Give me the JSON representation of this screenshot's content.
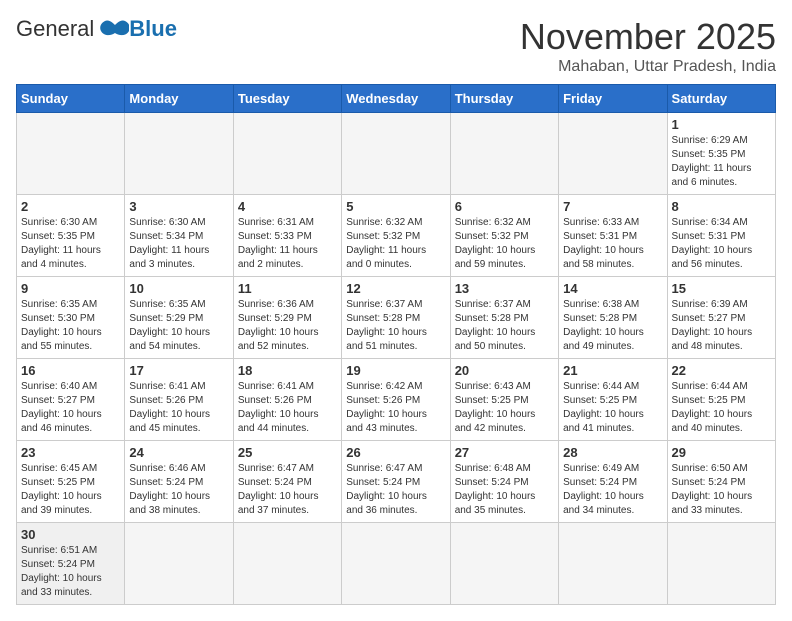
{
  "logo": {
    "general": "General",
    "blue": "Blue"
  },
  "title": "November 2025",
  "location": "Mahaban, Uttar Pradesh, India",
  "days_of_week": [
    "Sunday",
    "Monday",
    "Tuesday",
    "Wednesday",
    "Thursday",
    "Friday",
    "Saturday"
  ],
  "weeks": [
    [
      {
        "day": "",
        "info": "",
        "empty": true
      },
      {
        "day": "",
        "info": "",
        "empty": true
      },
      {
        "day": "",
        "info": "",
        "empty": true
      },
      {
        "day": "",
        "info": "",
        "empty": true
      },
      {
        "day": "",
        "info": "",
        "empty": true
      },
      {
        "day": "",
        "info": "",
        "empty": true
      },
      {
        "day": "1",
        "info": "Sunrise: 6:29 AM\nSunset: 5:35 PM\nDaylight: 11 hours\nand 6 minutes.",
        "empty": false
      }
    ],
    [
      {
        "day": "2",
        "info": "Sunrise: 6:30 AM\nSunset: 5:35 PM\nDaylight: 11 hours\nand 4 minutes.",
        "empty": false
      },
      {
        "day": "3",
        "info": "Sunrise: 6:30 AM\nSunset: 5:34 PM\nDaylight: 11 hours\nand 3 minutes.",
        "empty": false
      },
      {
        "day": "4",
        "info": "Sunrise: 6:31 AM\nSunset: 5:33 PM\nDaylight: 11 hours\nand 2 minutes.",
        "empty": false
      },
      {
        "day": "5",
        "info": "Sunrise: 6:32 AM\nSunset: 5:32 PM\nDaylight: 11 hours\nand 0 minutes.",
        "empty": false
      },
      {
        "day": "6",
        "info": "Sunrise: 6:32 AM\nSunset: 5:32 PM\nDaylight: 10 hours\nand 59 minutes.",
        "empty": false
      },
      {
        "day": "7",
        "info": "Sunrise: 6:33 AM\nSunset: 5:31 PM\nDaylight: 10 hours\nand 58 minutes.",
        "empty": false
      },
      {
        "day": "8",
        "info": "Sunrise: 6:34 AM\nSunset: 5:31 PM\nDaylight: 10 hours\nand 56 minutes.",
        "empty": false
      }
    ],
    [
      {
        "day": "9",
        "info": "Sunrise: 6:35 AM\nSunset: 5:30 PM\nDaylight: 10 hours\nand 55 minutes.",
        "empty": false
      },
      {
        "day": "10",
        "info": "Sunrise: 6:35 AM\nSunset: 5:29 PM\nDaylight: 10 hours\nand 54 minutes.",
        "empty": false
      },
      {
        "day": "11",
        "info": "Sunrise: 6:36 AM\nSunset: 5:29 PM\nDaylight: 10 hours\nand 52 minutes.",
        "empty": false
      },
      {
        "day": "12",
        "info": "Sunrise: 6:37 AM\nSunset: 5:28 PM\nDaylight: 10 hours\nand 51 minutes.",
        "empty": false
      },
      {
        "day": "13",
        "info": "Sunrise: 6:37 AM\nSunset: 5:28 PM\nDaylight: 10 hours\nand 50 minutes.",
        "empty": false
      },
      {
        "day": "14",
        "info": "Sunrise: 6:38 AM\nSunset: 5:28 PM\nDaylight: 10 hours\nand 49 minutes.",
        "empty": false
      },
      {
        "day": "15",
        "info": "Sunrise: 6:39 AM\nSunset: 5:27 PM\nDaylight: 10 hours\nand 48 minutes.",
        "empty": false
      }
    ],
    [
      {
        "day": "16",
        "info": "Sunrise: 6:40 AM\nSunset: 5:27 PM\nDaylight: 10 hours\nand 46 minutes.",
        "empty": false
      },
      {
        "day": "17",
        "info": "Sunrise: 6:41 AM\nSunset: 5:26 PM\nDaylight: 10 hours\nand 45 minutes.",
        "empty": false
      },
      {
        "day": "18",
        "info": "Sunrise: 6:41 AM\nSunset: 5:26 PM\nDaylight: 10 hours\nand 44 minutes.",
        "empty": false
      },
      {
        "day": "19",
        "info": "Sunrise: 6:42 AM\nSunset: 5:26 PM\nDaylight: 10 hours\nand 43 minutes.",
        "empty": false
      },
      {
        "day": "20",
        "info": "Sunrise: 6:43 AM\nSunset: 5:25 PM\nDaylight: 10 hours\nand 42 minutes.",
        "empty": false
      },
      {
        "day": "21",
        "info": "Sunrise: 6:44 AM\nSunset: 5:25 PM\nDaylight: 10 hours\nand 41 minutes.",
        "empty": false
      },
      {
        "day": "22",
        "info": "Sunrise: 6:44 AM\nSunset: 5:25 PM\nDaylight: 10 hours\nand 40 minutes.",
        "empty": false
      }
    ],
    [
      {
        "day": "23",
        "info": "Sunrise: 6:45 AM\nSunset: 5:25 PM\nDaylight: 10 hours\nand 39 minutes.",
        "empty": false
      },
      {
        "day": "24",
        "info": "Sunrise: 6:46 AM\nSunset: 5:24 PM\nDaylight: 10 hours\nand 38 minutes.",
        "empty": false
      },
      {
        "day": "25",
        "info": "Sunrise: 6:47 AM\nSunset: 5:24 PM\nDaylight: 10 hours\nand 37 minutes.",
        "empty": false
      },
      {
        "day": "26",
        "info": "Sunrise: 6:47 AM\nSunset: 5:24 PM\nDaylight: 10 hours\nand 36 minutes.",
        "empty": false
      },
      {
        "day": "27",
        "info": "Sunrise: 6:48 AM\nSunset: 5:24 PM\nDaylight: 10 hours\nand 35 minutes.",
        "empty": false
      },
      {
        "day": "28",
        "info": "Sunrise: 6:49 AM\nSunset: 5:24 PM\nDaylight: 10 hours\nand 34 minutes.",
        "empty": false
      },
      {
        "day": "29",
        "info": "Sunrise: 6:50 AM\nSunset: 5:24 PM\nDaylight: 10 hours\nand 33 minutes.",
        "empty": false
      }
    ],
    [
      {
        "day": "30",
        "info": "Sunrise: 6:51 AM\nSunset: 5:24 PM\nDaylight: 10 hours\nand 33 minutes.",
        "empty": false
      },
      {
        "day": "",
        "info": "",
        "empty": true
      },
      {
        "day": "",
        "info": "",
        "empty": true
      },
      {
        "day": "",
        "info": "",
        "empty": true
      },
      {
        "day": "",
        "info": "",
        "empty": true
      },
      {
        "day": "",
        "info": "",
        "empty": true
      },
      {
        "day": "",
        "info": "",
        "empty": true
      }
    ]
  ]
}
